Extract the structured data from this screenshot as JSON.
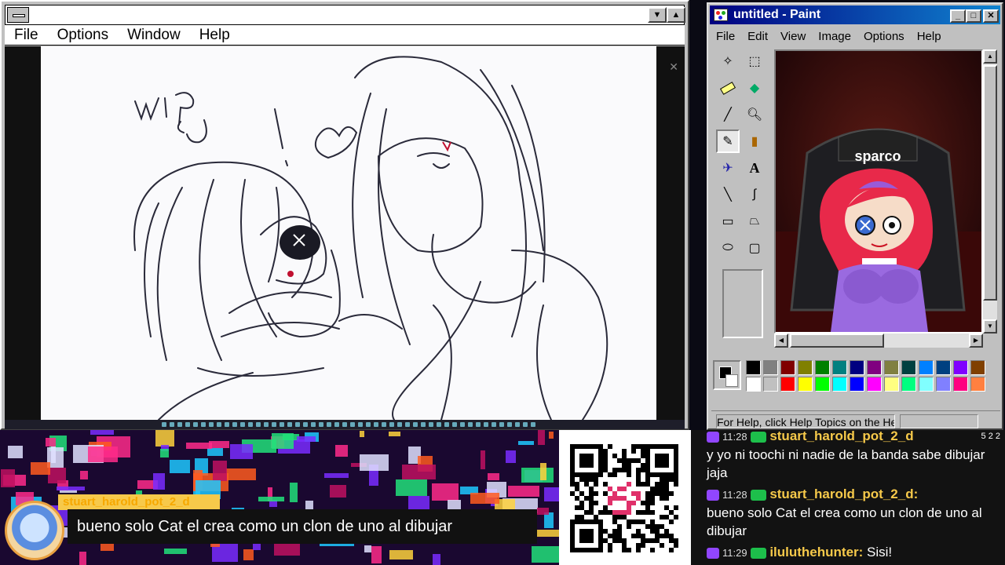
{
  "left_window": {
    "menu": [
      "File",
      "Options",
      "Window",
      "Help"
    ],
    "wip_text": "wip"
  },
  "paint": {
    "title": "untitled - Paint",
    "menu": [
      "File",
      "Edit",
      "View",
      "Image",
      "Options",
      "Help"
    ],
    "status_text": "For Help, click Help Topics on the Help Menu.",
    "chair_brand": "sparco",
    "palette_row1": [
      "#000000",
      "#808080",
      "#800000",
      "#808000",
      "#008000",
      "#008080",
      "#000080",
      "#800080",
      "#808040",
      "#004040",
      "#0080ff",
      "#004080",
      "#8000ff",
      "#804000"
    ],
    "palette_row2": [
      "#ffffff",
      "#c0c0c0",
      "#ff0000",
      "#ffff00",
      "#00ff00",
      "#00ffff",
      "#0000ff",
      "#ff00ff",
      "#ffff80",
      "#00ff80",
      "#80ffff",
      "#8080ff",
      "#ff0080",
      "#ff8040"
    ]
  },
  "overlay": {
    "bubble_user": "stuart_harold_pot_2_d",
    "bubble_text": "bueno solo Cat el crea como un clon de uno al dibujar"
  },
  "chat": {
    "top_counts": "5  2  2",
    "messages": [
      {
        "time": "11:28",
        "user": "stuart_harold_pot_2_d",
        "text": "y yo ni toochi ni nadie de la banda sabe dibujar jaja"
      },
      {
        "time": "11:28",
        "user": "stuart_harold_pot_2_d:",
        "text": "bueno solo Cat el crea como un clon de uno al dibujar"
      },
      {
        "time": "11:29",
        "user": "iluluthehunter:",
        "text": "Sisi!"
      }
    ]
  }
}
